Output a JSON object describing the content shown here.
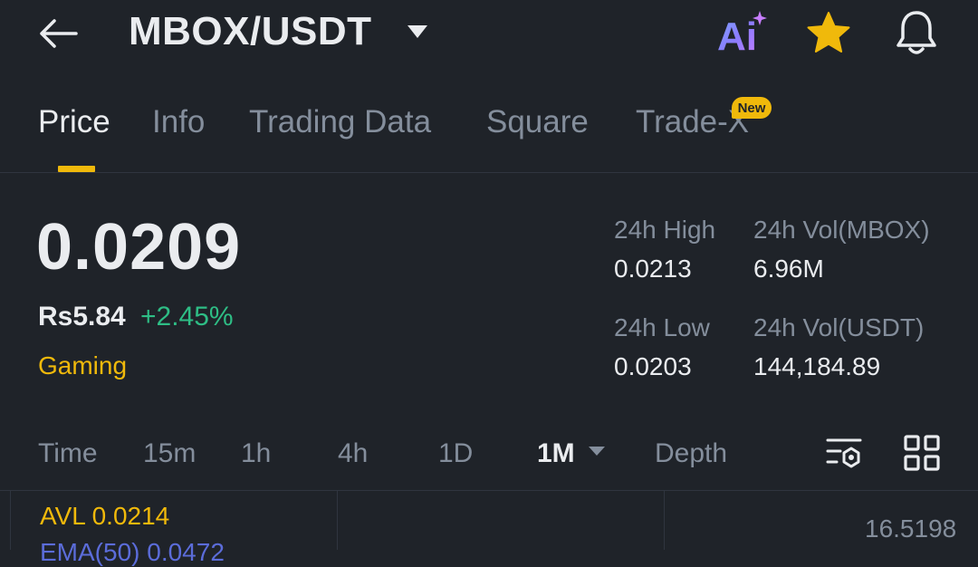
{
  "header": {
    "pair": "MBOX/USDT",
    "icons": [
      "back-arrow-icon",
      "caret-down-icon",
      "ai-icon",
      "star-icon",
      "bell-icon"
    ],
    "ai_label": "Ai"
  },
  "tabs": [
    {
      "label": "Price",
      "active": true
    },
    {
      "label": "Info",
      "active": false
    },
    {
      "label": "Trading Data",
      "active": false
    },
    {
      "label": "Square",
      "active": false
    },
    {
      "label": "Trade-X",
      "active": false,
      "badge": "New"
    }
  ],
  "price": {
    "last": "0.0209",
    "fiat": "Rs5.84",
    "change": "+2.45%",
    "category": "Gaming"
  },
  "stats": {
    "high_label": "24h High",
    "high_value": "0.0213",
    "vol_base_label": "24h Vol(MBOX)",
    "vol_base_value": "6.96M",
    "low_label": "24h Low",
    "low_value": "0.0203",
    "vol_quote_label": "24h Vol(USDT)",
    "vol_quote_value": "144,184.89"
  },
  "intervals": [
    {
      "label": "Time",
      "active": false
    },
    {
      "label": "15m",
      "active": false
    },
    {
      "label": "1h",
      "active": false
    },
    {
      "label": "4h",
      "active": false
    },
    {
      "label": "1D",
      "active": false
    },
    {
      "label": "1M",
      "active": true
    },
    {
      "label": "Depth",
      "active": false
    }
  ],
  "chart": {
    "avl": "AVL 0.0214",
    "ema": "EMA(50)  0.0472",
    "axis_value": "16.5198"
  },
  "colors": {
    "background": "#1f2329",
    "accent": "#f0b90b",
    "positive": "#2ebd85",
    "muted": "#848e9c",
    "ema": "#5b6cd9"
  }
}
